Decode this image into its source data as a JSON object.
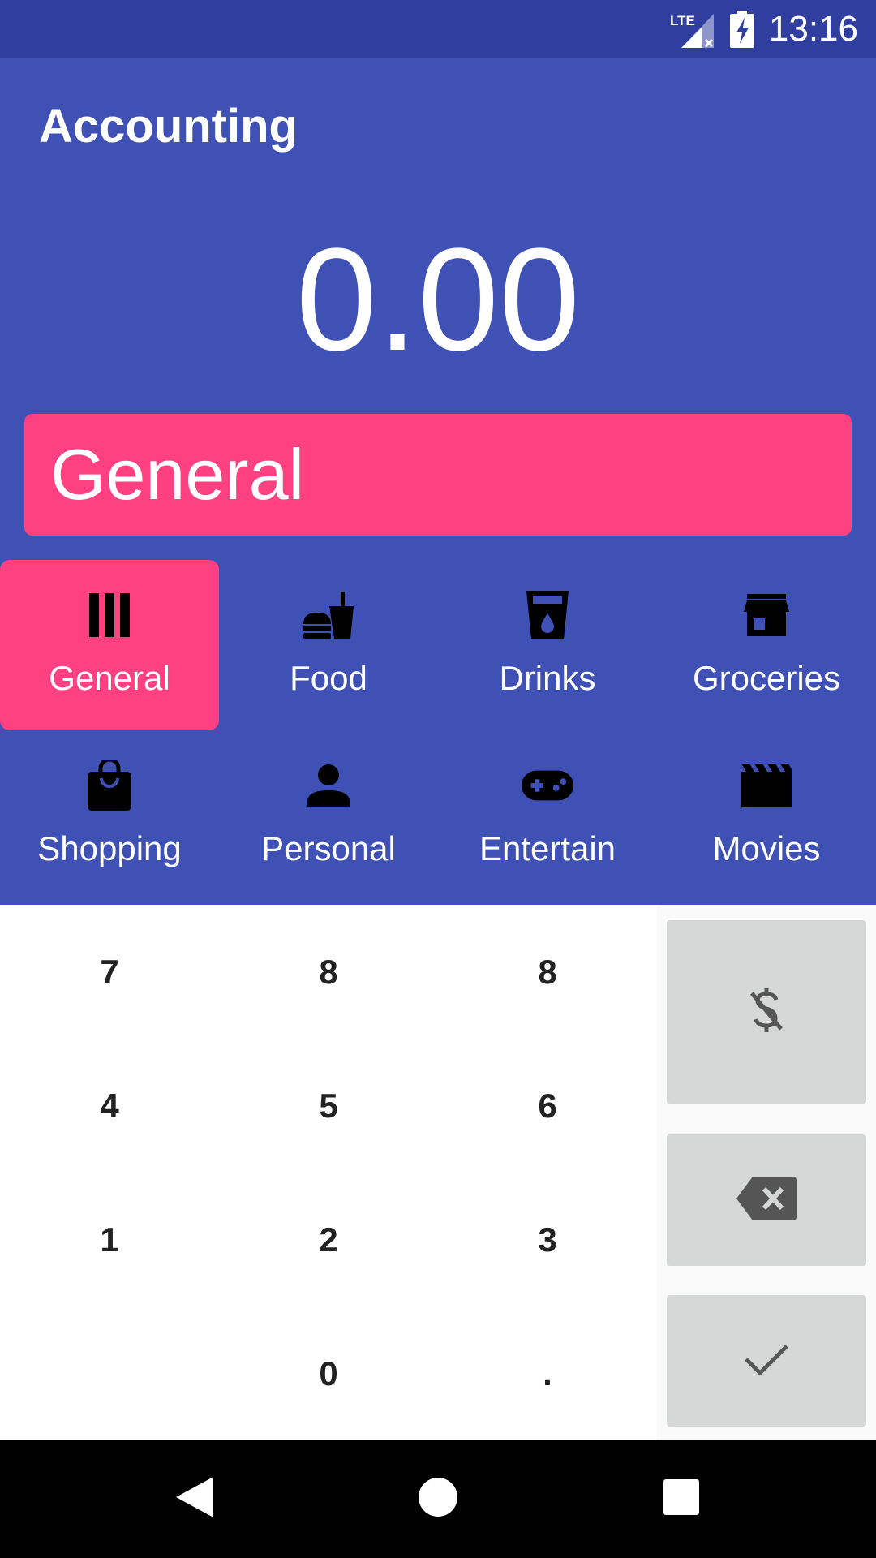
{
  "status_bar": {
    "time": "13:16",
    "network_label": "LTE",
    "icons": [
      "lte-signal-icon",
      "battery-charging-icon"
    ]
  },
  "app": {
    "title": "Accounting"
  },
  "amount": "0.00",
  "selected_category": "General",
  "categories": [
    {
      "label": "General",
      "icon": "general-icon",
      "selected": true
    },
    {
      "label": "Food",
      "icon": "food-icon",
      "selected": false
    },
    {
      "label": "Drinks",
      "icon": "drinks-icon",
      "selected": false
    },
    {
      "label": "Groceries",
      "icon": "groceries-icon",
      "selected": false
    },
    {
      "label": "Shopping",
      "icon": "shopping-icon",
      "selected": false
    },
    {
      "label": "Personal",
      "icon": "personal-icon",
      "selected": false
    },
    {
      "label": "Entertain",
      "icon": "entertain-icon",
      "selected": false
    },
    {
      "label": "Movies",
      "icon": "movies-icon",
      "selected": false
    }
  ],
  "keypad": {
    "rows": [
      [
        "7",
        "8",
        "8"
      ],
      [
        "4",
        "5",
        "6"
      ],
      [
        "1",
        "2",
        "3"
      ],
      [
        "",
        "0",
        "."
      ]
    ],
    "actions": [
      "no-currency-icon",
      "backspace-icon",
      "check-icon"
    ]
  },
  "nav_bar": {
    "buttons": [
      "back-icon",
      "home-icon",
      "recents-icon"
    ]
  },
  "colors": {
    "primary": "#3F51B5",
    "primary_dark": "#303F9F",
    "accent": "#FF4081",
    "action_bg": "#D6D7D7"
  }
}
